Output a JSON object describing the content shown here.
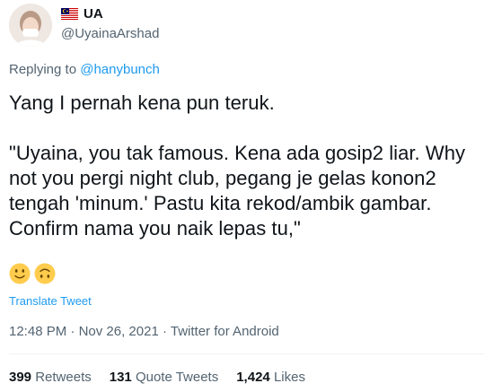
{
  "author": {
    "display_name": "UA",
    "handle": "@UyainaArshad"
  },
  "reply": {
    "prefix": "Replying to",
    "handle": "@hanybunch"
  },
  "tweet": {
    "text": "Yang I pernah kena pun teruk.\n\n\"Uyaina, you tak famous. Kena ada gosip2 liar. Why not you pergi night club, pegang je gelas konon2 tengah 'minum.' Pastu kita rekod/ambik gambar. Confirm nama you naik lepas tu,\"",
    "emojis": [
      "slightly-smiling-face",
      "upside-down-face"
    ],
    "translate_label": "Translate Tweet"
  },
  "meta": {
    "time": "12:48 PM",
    "date": "Nov 26, 2021",
    "source": "Twitter for Android",
    "separator": "·"
  },
  "stats": {
    "retweets": {
      "value": "399",
      "label": "Retweets"
    },
    "quote_tweets": {
      "value": "131",
      "label": "Quote Tweets"
    },
    "likes": {
      "value": "1,424",
      "label": "Likes"
    }
  },
  "colors": {
    "link": "#1d9bf0",
    "secondary_text": "#536471",
    "primary_text": "#0f1419",
    "divider": "#eff3f4",
    "emoji_yellow": "#ffcc4d"
  },
  "icons": {
    "flag": "malaysia-flag-icon"
  }
}
